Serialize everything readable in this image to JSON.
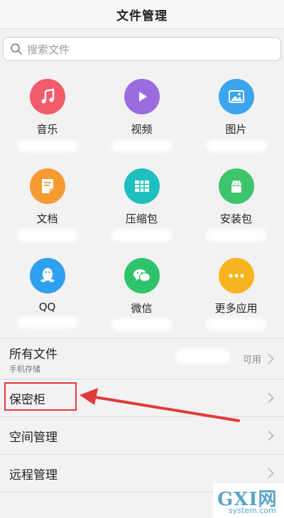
{
  "header": {
    "title": "文件管理"
  },
  "search": {
    "placeholder": "搜索文件"
  },
  "categories": [
    {
      "label": "音乐",
      "icon": "music-icon",
      "color": "#f25b6b"
    },
    {
      "label": "视频",
      "icon": "video-icon",
      "color": "#9b6be0"
    },
    {
      "label": "图片",
      "icon": "image-icon",
      "color": "#3ba5ee"
    },
    {
      "label": "文档",
      "icon": "document-icon",
      "color": "#f69a32"
    },
    {
      "label": "压缩包",
      "icon": "archive-icon",
      "color": "#1fbfbf"
    },
    {
      "label": "安装包",
      "icon": "android-icon",
      "color": "#3ec46d"
    },
    {
      "label": "QQ",
      "icon": "qq-penguin-icon",
      "color": "#2f9ff0"
    },
    {
      "label": "微信",
      "icon": "wechat-icon",
      "color": "#2fc46b"
    },
    {
      "label": "更多应用",
      "icon": "more-icon",
      "color": "#f6b51e"
    }
  ],
  "list": {
    "all_files": {
      "title": "所有文件",
      "subtitle": "手机存储",
      "status": "可用"
    },
    "safe": {
      "label": "保密柜"
    },
    "space": {
      "label": "空间管理"
    },
    "remote": {
      "label": "远程管理"
    }
  },
  "annotation": {
    "color": "#e23a3a"
  },
  "watermark": {
    "brand": "GXI网",
    "site": "system.com"
  }
}
